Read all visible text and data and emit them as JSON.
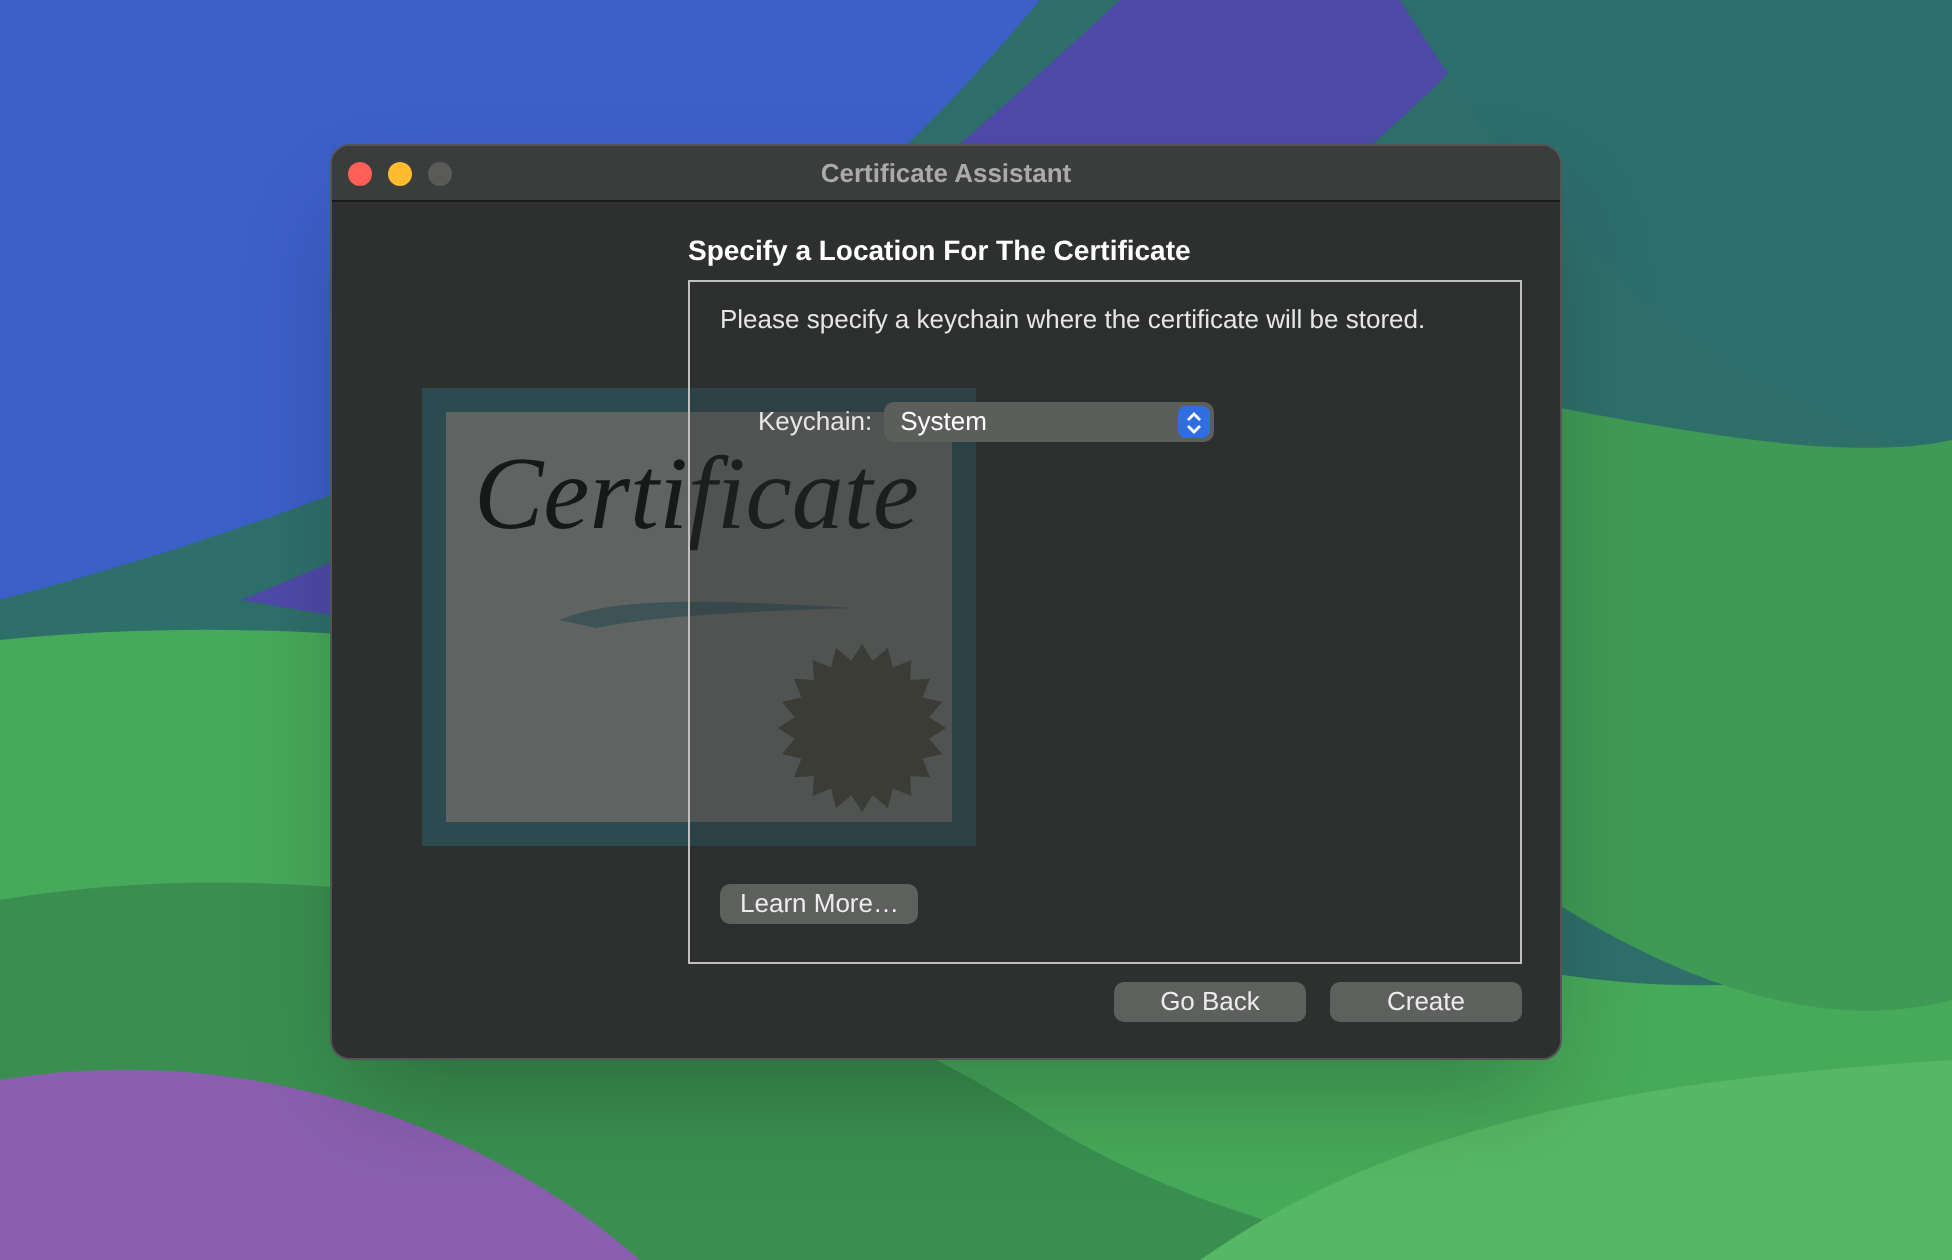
{
  "window": {
    "title": "Certificate Assistant",
    "traffic_lights": [
      {
        "color": "#ff5f57"
      },
      {
        "color": "#febc2e"
      },
      {
        "color": "#5a5b59"
      }
    ]
  },
  "illustration": {
    "text": "Certificate"
  },
  "heading": "Specify a Location For The Certificate",
  "panel": {
    "message": "Please specify a keychain where the certificate will be stored.",
    "keychain": {
      "label": "Keychain:",
      "value": "System"
    },
    "learn_more": "Learn More…"
  },
  "buttons": [
    {
      "label": "Go Back"
    },
    {
      "label": "Create"
    }
  ]
}
